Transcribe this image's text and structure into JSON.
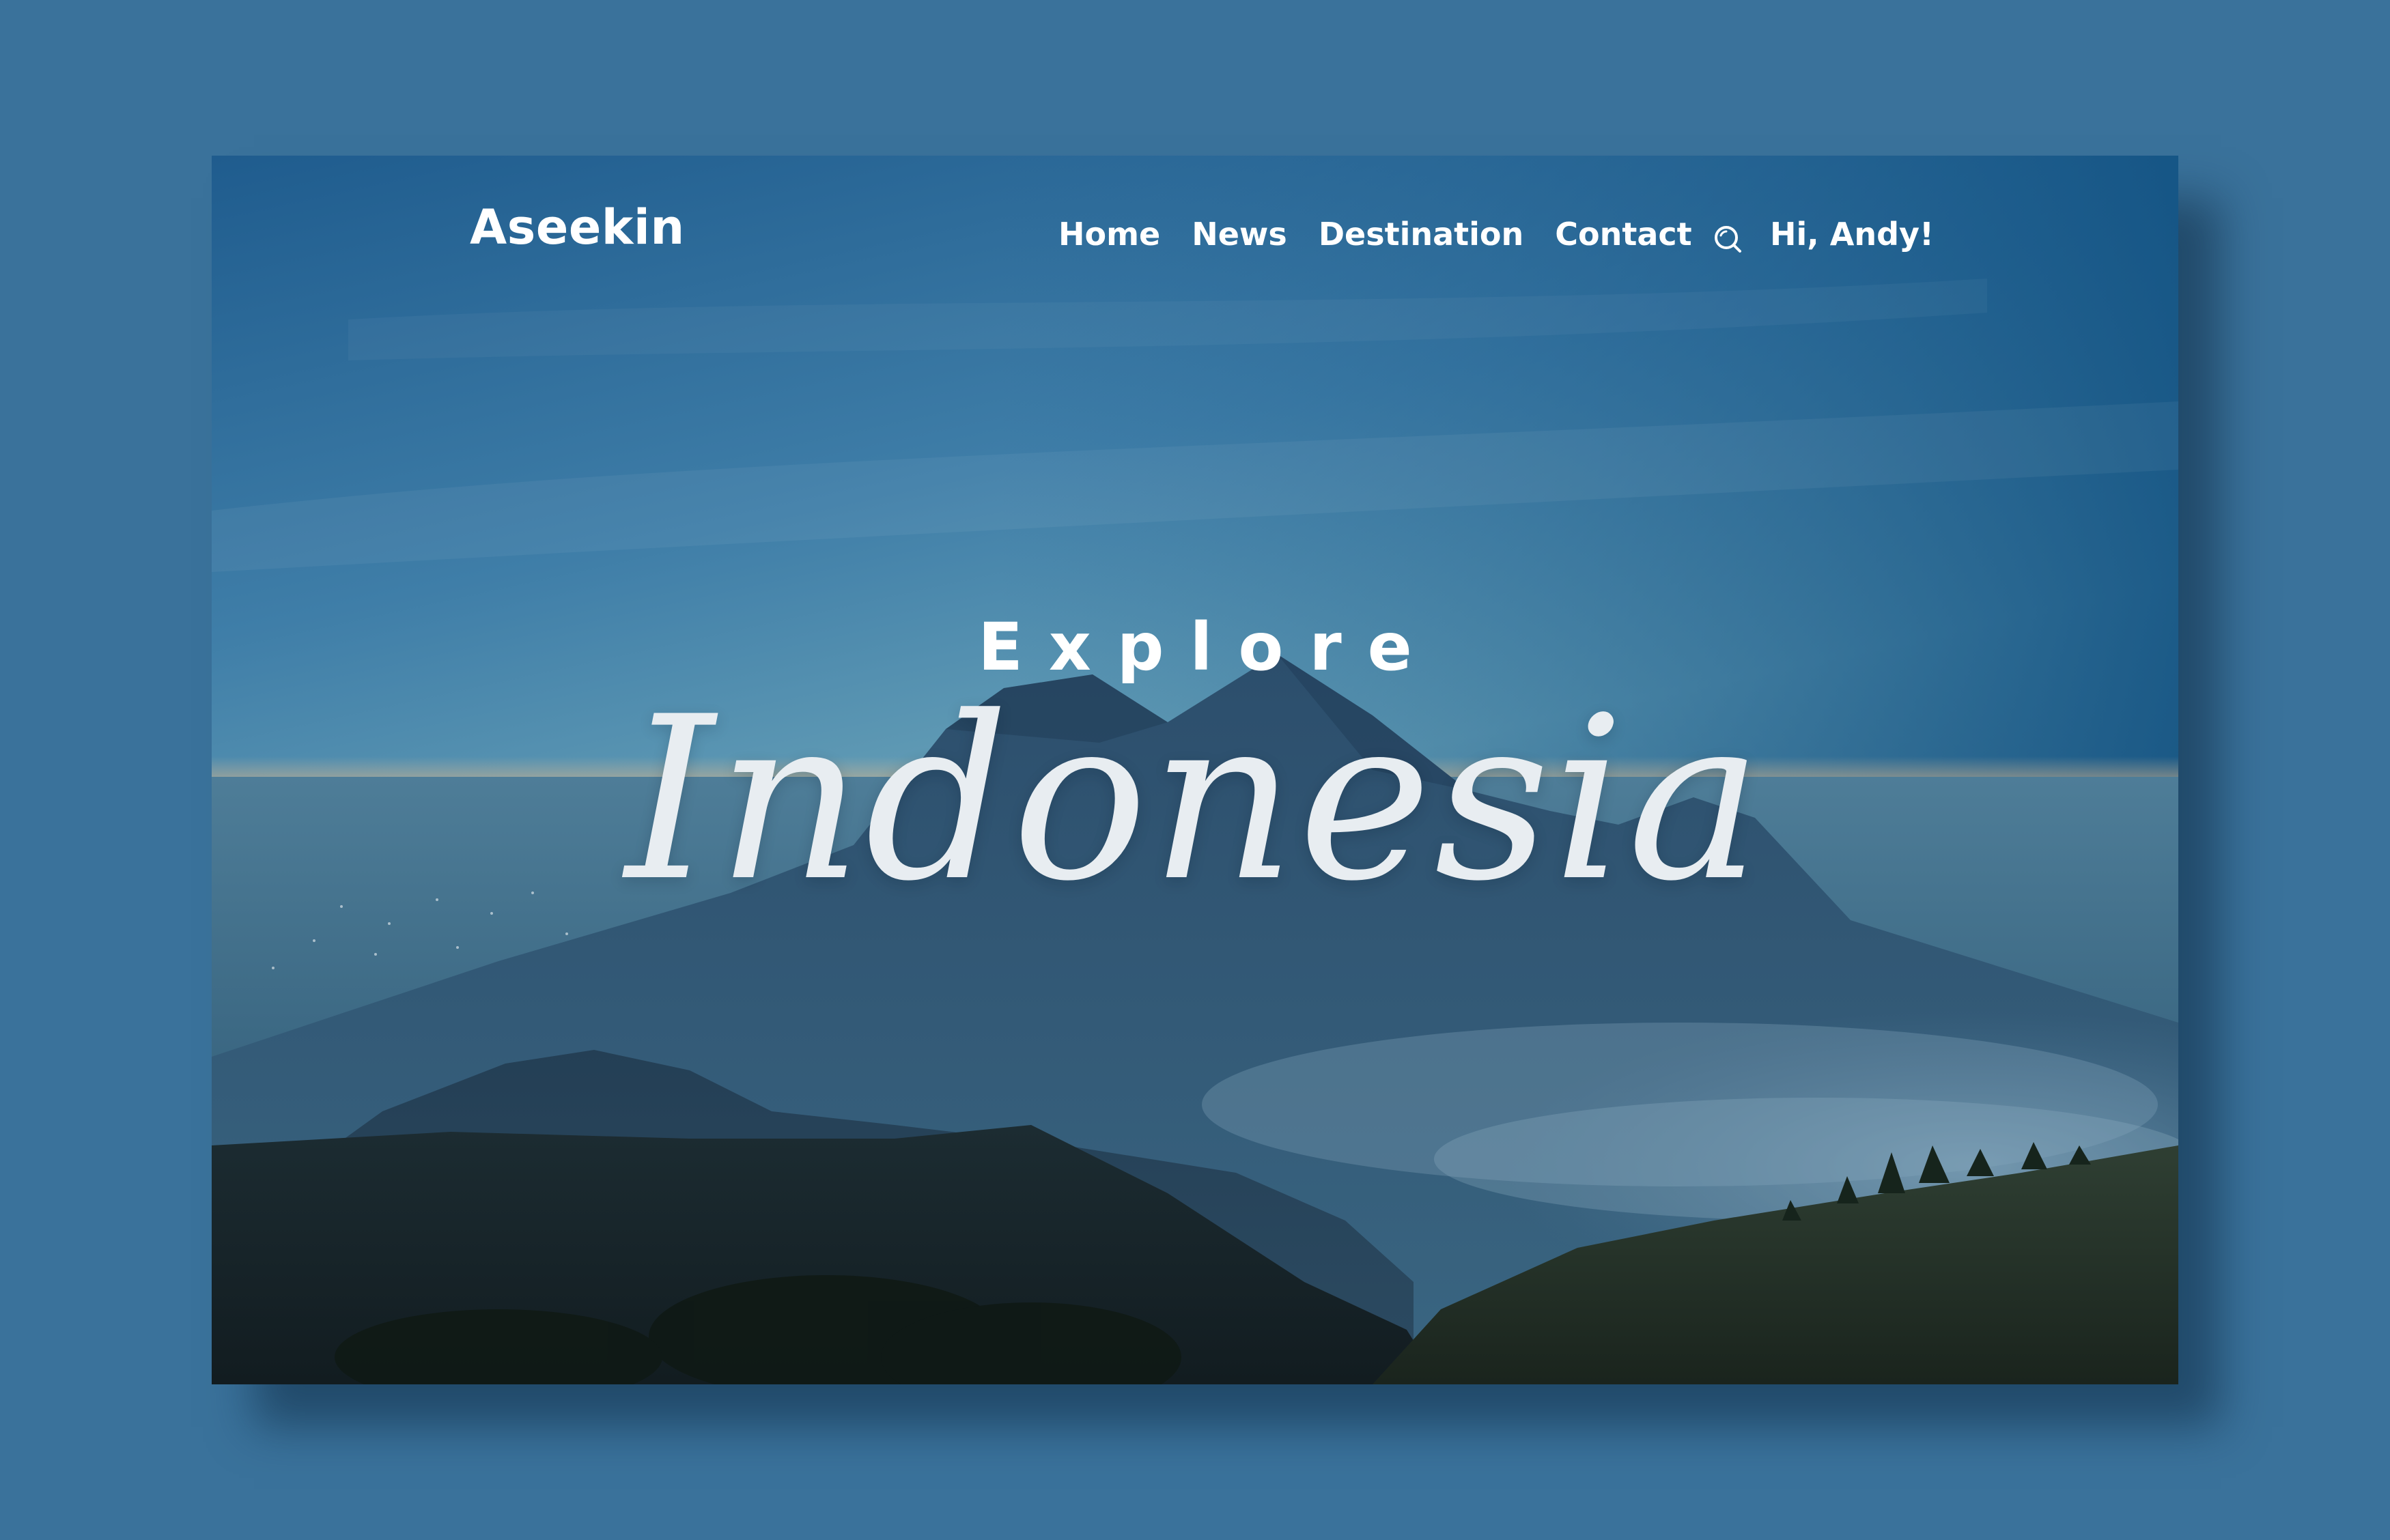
{
  "site": {
    "brand": "Aseekin"
  },
  "nav": {
    "items": [
      {
        "label": "Home"
      },
      {
        "label": "News"
      },
      {
        "label": "Destination"
      },
      {
        "label": "Contact"
      }
    ],
    "search_icon": "search-icon",
    "greeting": "Hi, Andy!"
  },
  "hero": {
    "eyebrow": "Explore",
    "title": "Indonesia"
  },
  "colors": {
    "page_background": "#3a729b",
    "text": "#ffffff",
    "title_text": "#e8edf1"
  }
}
